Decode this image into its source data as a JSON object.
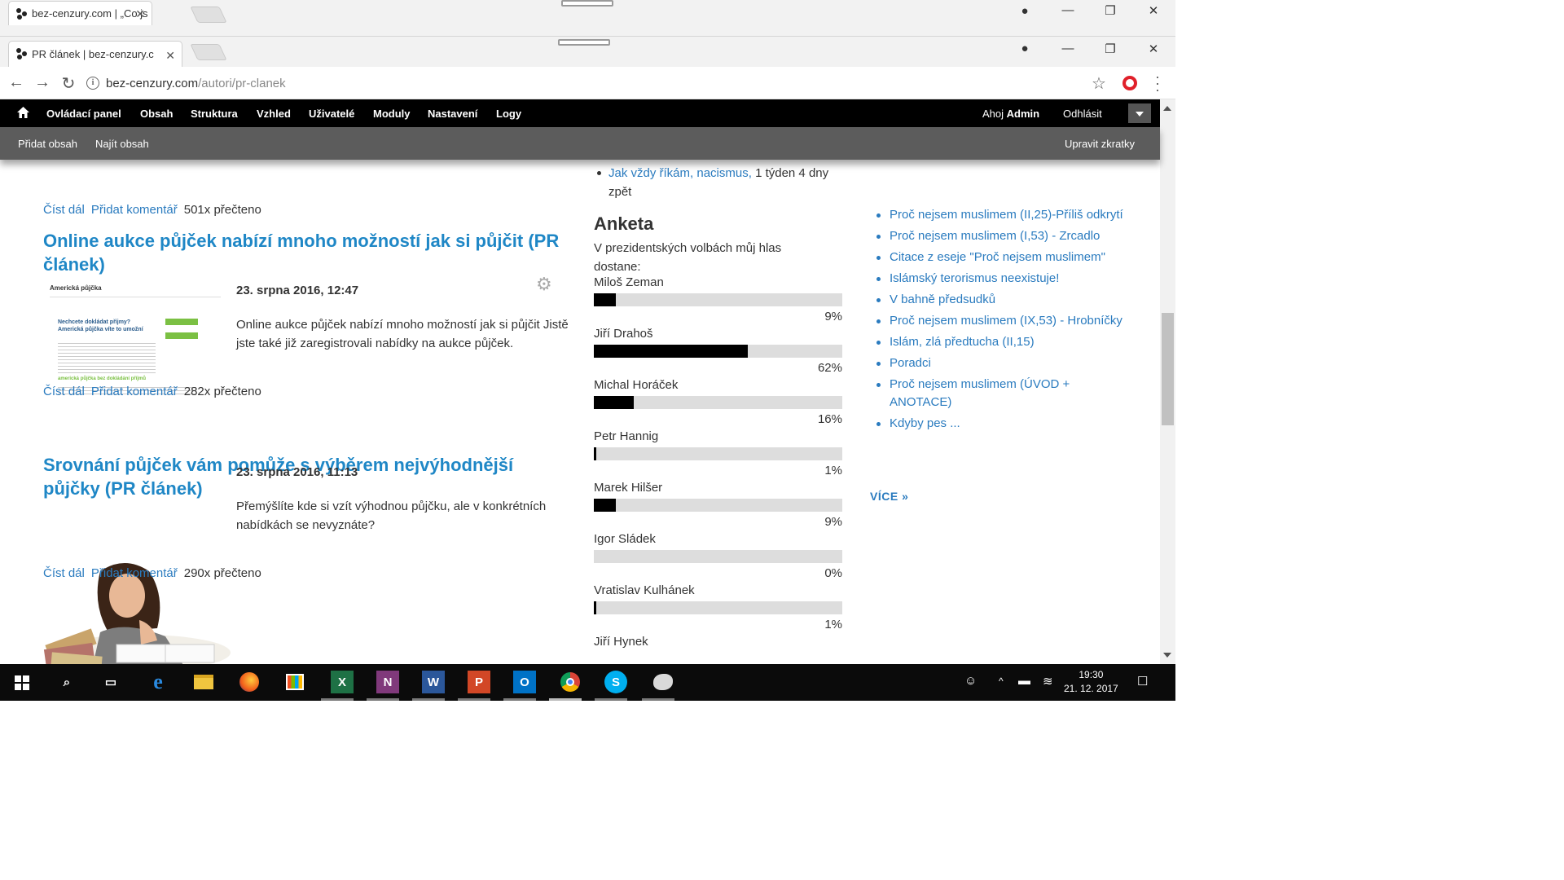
{
  "back_window": {
    "tab_title": "bez-cenzury.com | „Co js"
  },
  "browser": {
    "tab_title": "PR článek | bez-cenzury.c",
    "url_host": "bez-cenzury.com",
    "url_path": "/autori/pr-clanek"
  },
  "admin_menu": {
    "items": [
      "Ovládací panel",
      "Obsah",
      "Struktura",
      "Vzhled",
      "Uživatelé",
      "Moduly",
      "Nastavení",
      "Logy"
    ],
    "greeting": "Ahoj",
    "username": "Admin",
    "logout": "Odhlásit"
  },
  "shortcuts": {
    "add_content": "Přidat obsah",
    "find_content": "Najít obsah",
    "edit_shortcuts": "Upravit zkratky"
  },
  "articles": {
    "read_more": "Číst dál",
    "add_comment": "Přidat komentář",
    "top_count": "501x přečteno",
    "items": [
      {
        "title": "Online aukce půjček nabízí mnoho možností jak si půjčit (PR článek)",
        "date": "23. srpna 2016,  12:47",
        "body": "Online aukce půjček nabízí mnoho možností jak si půjčit Jistě jste také již zaregistrovali nabídky na aukce půjček.",
        "count": "282x přečteno",
        "thumb_heading": "Americká půjčka",
        "thumb_sub": "Nechcete dokládat příjmy? Americká půjčka víte to umožní",
        "thumb_green": "americká půjčka bez dokládání příjmů"
      },
      {
        "title": "Srovnání půjček vám pomůže s výběrem nejvýhodnější půjčky (PR článek)",
        "date": "23. srpna 2016,  11:13",
        "body": "Přemýšlíte kde si vzít výhodnou půjčku, ale v konkrétních nabídkách se nevyznáte?",
        "count": "290x přečteno"
      }
    ]
  },
  "mid_list_item": {
    "link": "Jak vždy říkám, nacismus,",
    "suffix": "1 týden 4 dny zpět"
  },
  "poll": {
    "title": "Anketa",
    "question": "V prezidentských volbách můj hlas dostane:",
    "options": [
      {
        "name": "Miloš Zeman",
        "percent": 9,
        "label": "9%"
      },
      {
        "name": "Jiří Drahoš",
        "percent": 62,
        "label": "62%"
      },
      {
        "name": "Michal Horáček",
        "percent": 16,
        "label": "16%"
      },
      {
        "name": "Petr Hannig",
        "percent": 1,
        "label": "1%"
      },
      {
        "name": "Marek Hilšer",
        "percent": 9,
        "label": "9%"
      },
      {
        "name": "Igor Sládek",
        "percent": 0,
        "label": "0%"
      },
      {
        "name": "Vratislav Kulhánek",
        "percent": 1,
        "label": "1%"
      },
      {
        "name": "Jiří Hynek",
        "percent": null,
        "label": ""
      }
    ]
  },
  "sidebar": {
    "links": [
      "Proč nejsem muslimem (II,25)-Příliš odkrytí",
      "Proč nejsem muslimem (I,53) - Zrcadlo",
      "Citace z eseje \"Proč nejsem muslimem\"",
      "Islámský terorismus neexistuje!",
      "V bahně předsudků",
      "Proč nejsem muslimem (IX,53) - Hrobníčky",
      "Islám, zlá předtucha (II,15)",
      "Poradci",
      "Proč nejsem muslimem (ÚVOD + ANOTACE)",
      "Kdyby pes ..."
    ],
    "more": "VÍCE »"
  },
  "taskbar": {
    "time": "19:30",
    "date": "21. 12. 2017"
  },
  "colors": {
    "link": "#2a7bbf",
    "title": "#1f87c6",
    "admin_bar": "#000000",
    "shortcut_bar": "#5c5c5c",
    "poll_fill": "#000000",
    "poll_track": "#dddddd"
  }
}
